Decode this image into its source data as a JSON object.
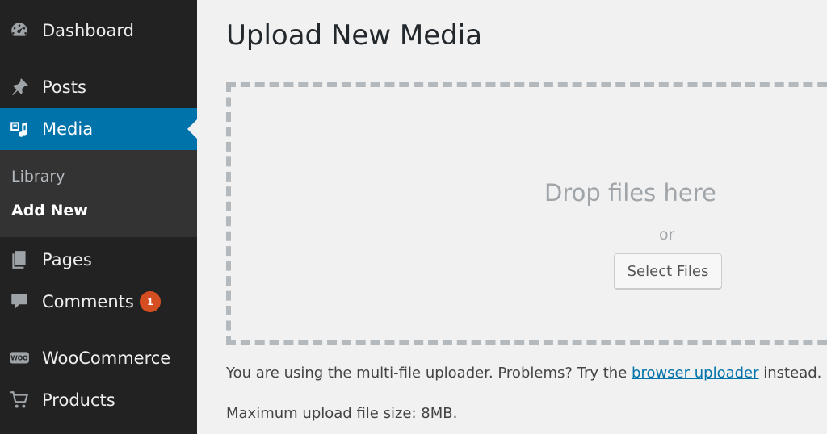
{
  "sidebar": {
    "items": [
      {
        "label": "Dashboard",
        "icon": "dashboard-icon"
      },
      {
        "label": "Posts",
        "icon": "pin-icon"
      },
      {
        "label": "Media",
        "icon": "media-icon",
        "active": true
      },
      {
        "label": "Pages",
        "icon": "pages-icon"
      },
      {
        "label": "Comments",
        "icon": "comment-icon",
        "badge": "1"
      },
      {
        "label": "WooCommerce",
        "icon": "woo-icon"
      },
      {
        "label": "Products",
        "icon": "cart-icon"
      }
    ],
    "submenu": {
      "library": "Library",
      "add_new": "Add New"
    }
  },
  "main": {
    "title": "Upload New Media",
    "drop_zone": {
      "drop_text": "Drop files here",
      "or_text": "or",
      "select_button": "Select Files"
    },
    "info": {
      "prefix": "You are using the multi-file uploader. Problems? Try the ",
      "link": "browser uploader",
      "suffix": " instead."
    },
    "max_size": "Maximum upload file size: 8MB."
  },
  "colors": {
    "sidebar_bg": "#222222",
    "active_bg": "#0073aa",
    "badge_bg": "#d54e21",
    "link": "#0073aa"
  }
}
